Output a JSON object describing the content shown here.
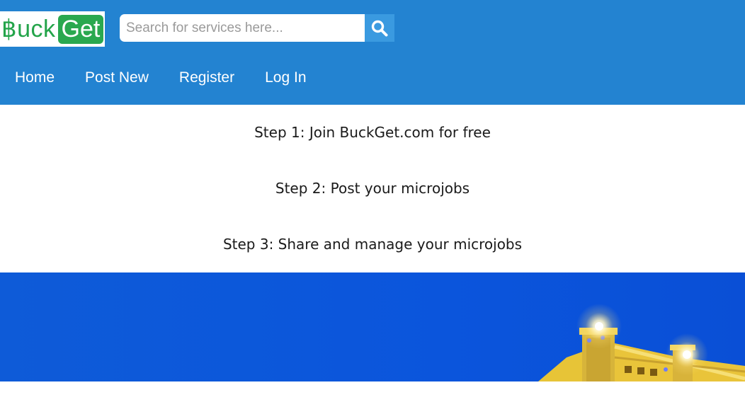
{
  "brand": {
    "logo_part1": "฿uck",
    "logo_part2": "Get"
  },
  "search": {
    "placeholder": "Search for services here..."
  },
  "nav": {
    "items": [
      {
        "label": "Home"
      },
      {
        "label": "Post New"
      },
      {
        "label": "Register"
      },
      {
        "label": "Log In"
      }
    ]
  },
  "steps": [
    {
      "text": "Step 1: Join BuckGet.com for free"
    },
    {
      "text": "Step 2: Post your microjobs"
    },
    {
      "text": "Step 3: Share and manage your microjobs"
    }
  ],
  "colors": {
    "header_bg": "#2383d1",
    "logo_green": "#24a44a",
    "search_button": "#3a9ae0",
    "hero_blue": "#0b55dc"
  },
  "icons": {
    "search": "search-icon"
  }
}
